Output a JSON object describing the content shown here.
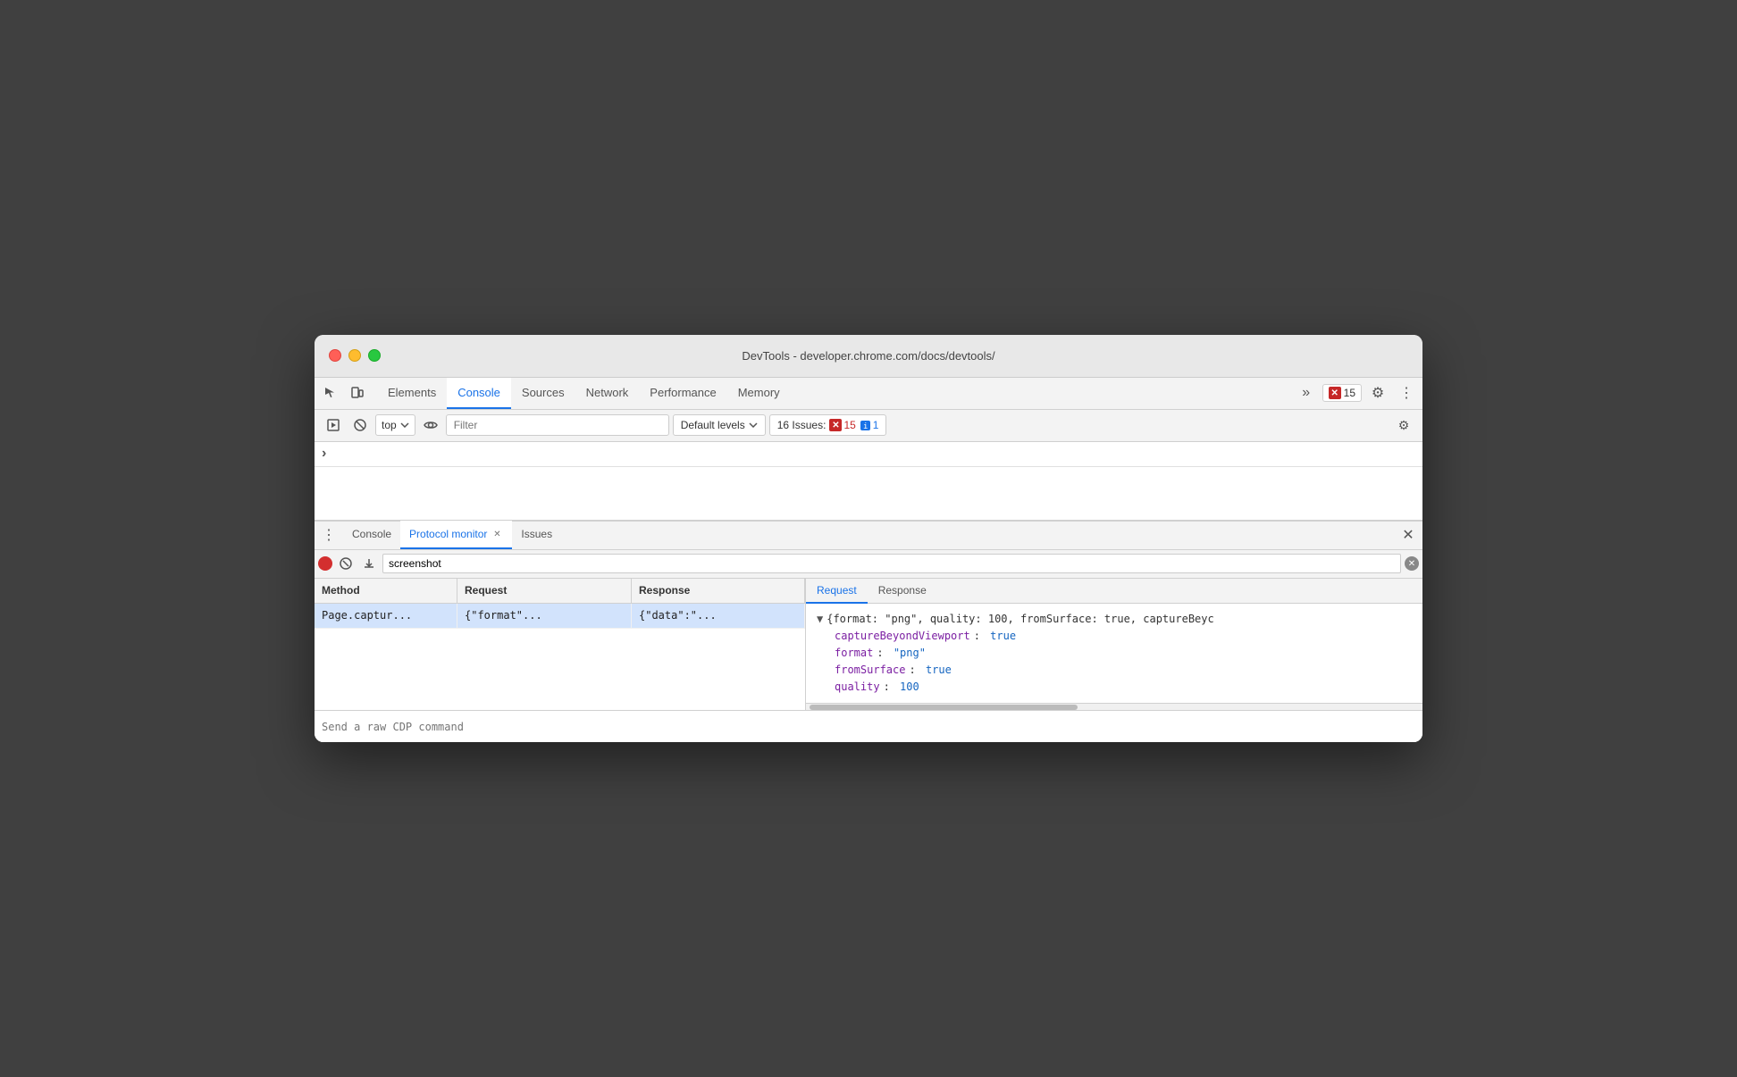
{
  "window": {
    "title": "DevTools - developer.chrome.com/docs/devtools/"
  },
  "top_tabs": {
    "items": [
      {
        "label": "Elements",
        "active": false
      },
      {
        "label": "Console",
        "active": true
      },
      {
        "label": "Sources",
        "active": false
      },
      {
        "label": "Network",
        "active": false
      },
      {
        "label": "Performance",
        "active": false
      },
      {
        "label": "Memory",
        "active": false
      }
    ],
    "more_label": "»",
    "error_count": "15"
  },
  "toolbar": {
    "top_selector_value": "top",
    "filter_placeholder": "Filter",
    "default_levels_label": "Default levels",
    "issues_label": "16 Issues:",
    "issues_error_count": "15",
    "issues_info_count": "1"
  },
  "arrow_row": {
    "symbol": "›"
  },
  "drawer": {
    "tabs": [
      {
        "label": "Console",
        "active": false,
        "closable": false
      },
      {
        "label": "Protocol monitor",
        "active": true,
        "closable": true
      },
      {
        "label": "Issues",
        "active": false,
        "closable": false
      }
    ]
  },
  "protocol_monitor": {
    "search_value": "screenshot",
    "table": {
      "headers": [
        "Method",
        "Request",
        "Response"
      ],
      "rows": [
        {
          "method": "Page.captur...",
          "request": "{\"format\"...",
          "response": "{\"data\":\"..."
        }
      ]
    },
    "detail": {
      "tabs": [
        {
          "label": "Request",
          "active": true
        },
        {
          "label": "Response",
          "active": false
        }
      ],
      "summary_line": "{format: \"png\", quality: 100, fromSurface: true, captureBeyc",
      "properties": [
        {
          "key": "captureBeyondViewport",
          "value": "true",
          "type": "bool"
        },
        {
          "key": "format",
          "value": "\"png\"",
          "type": "string"
        },
        {
          "key": "fromSurface",
          "value": "true",
          "type": "bool"
        },
        {
          "key": "quality",
          "value": "100",
          "type": "num"
        }
      ]
    }
  },
  "bottom_bar": {
    "placeholder": "Send a raw CDP command"
  }
}
